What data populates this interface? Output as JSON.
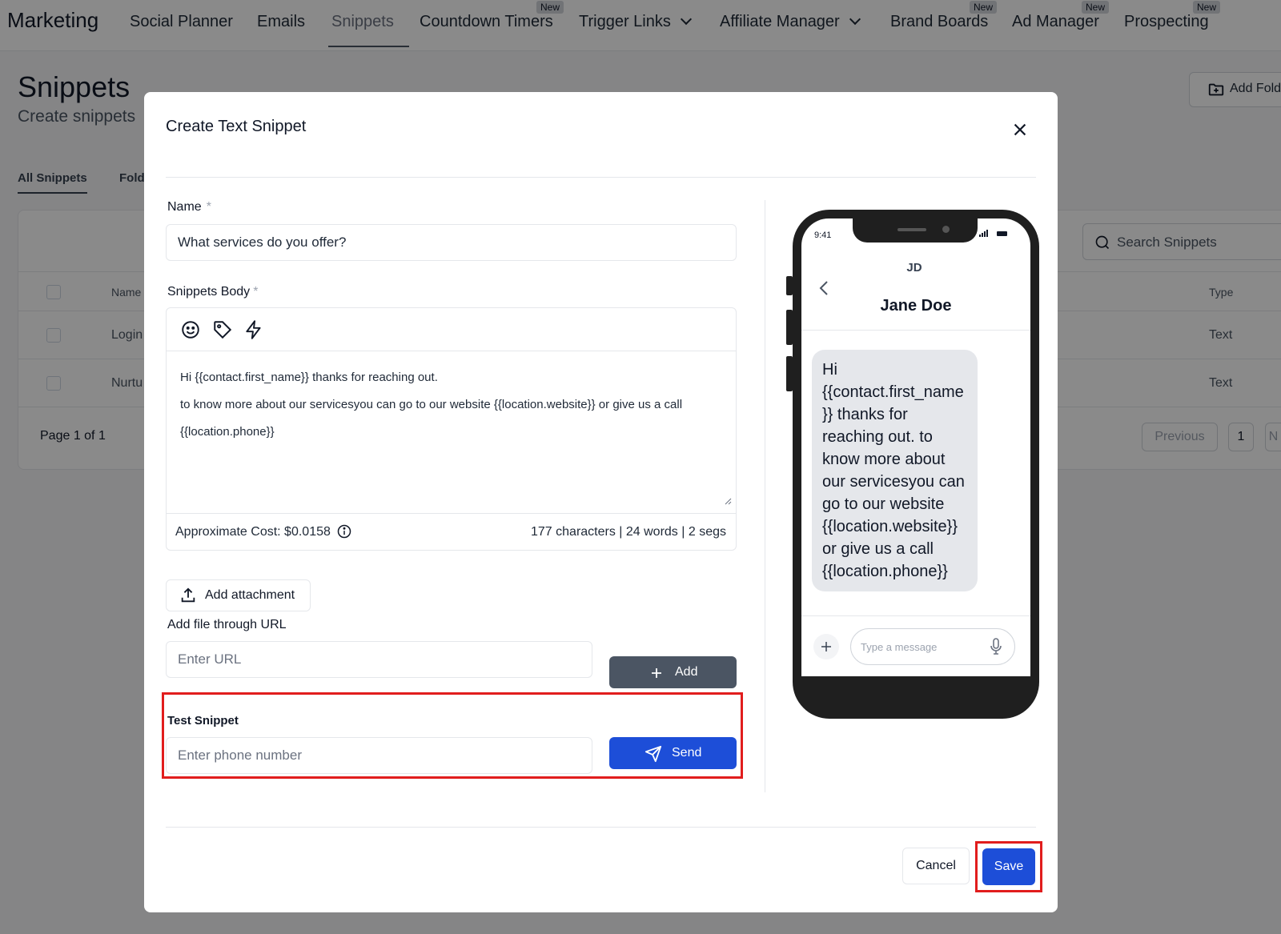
{
  "nav": {
    "brand": "Marketing",
    "items": [
      {
        "label": "Social Planner"
      },
      {
        "label": "Emails"
      },
      {
        "label": "Snippets"
      },
      {
        "label": "Countdown Timers",
        "badge": "New"
      },
      {
        "label": "Trigger Links"
      },
      {
        "label": "Affiliate Manager"
      },
      {
        "label": "Brand Boards",
        "badge": "New"
      },
      {
        "label": "Ad Manager",
        "badge": "New"
      },
      {
        "label": "Prospecting",
        "badge": "New"
      }
    ]
  },
  "page": {
    "title": "Snippets",
    "subtitle": "Create snippets",
    "add_folder": "Add Fold",
    "tabs": [
      "All Snippets",
      "Fold"
    ],
    "search_placeholder": "Search Snippets",
    "columns": {
      "name": "Name",
      "type": "Type"
    },
    "rows": [
      {
        "name": "Login",
        "type": "Text"
      },
      {
        "name": "Nurtu",
        "type": "Text"
      }
    ],
    "pager": {
      "text": "Page 1 of 1",
      "previous": "Previous",
      "page": "1",
      "next": "N"
    }
  },
  "modal": {
    "title": "Create Text Snippet",
    "name_label": "Name",
    "required_mark": "*",
    "name_value": "What services do you offer?",
    "body_label": "Snippets Body",
    "body_lines": [
      "Hi {{contact.first_name}} thanks for reaching out.",
      "to know more about our servicesyou can go to our website {{location.website}} or give us a call",
      "{{location.phone}}"
    ],
    "cost": "Approximate Cost: $0.0158",
    "counts": "177 characters | 24 words | 2 segs",
    "attach_label": "Add attachment",
    "url_label": "Add file through URL",
    "url_placeholder": "Enter URL",
    "add_label": "Add",
    "test_label": "Test Snippet",
    "phone_placeholder": "Enter phone number",
    "send_label": "Send",
    "cancel_label": "Cancel",
    "save_label": "Save"
  },
  "preview": {
    "time": "9:41",
    "initials": "JD",
    "contact_name": "Jane Doe",
    "message": "Hi {{contact.first_name}} thanks for reaching out. to know more about our servicesyou can go to our website {{location.website}} or give us a call {{location.phone}}",
    "input_placeholder": "Type a message"
  },
  "colors": {
    "primary": "#1d4ed8",
    "highlight": "#e11d1d",
    "add_button": "#4b5563"
  }
}
